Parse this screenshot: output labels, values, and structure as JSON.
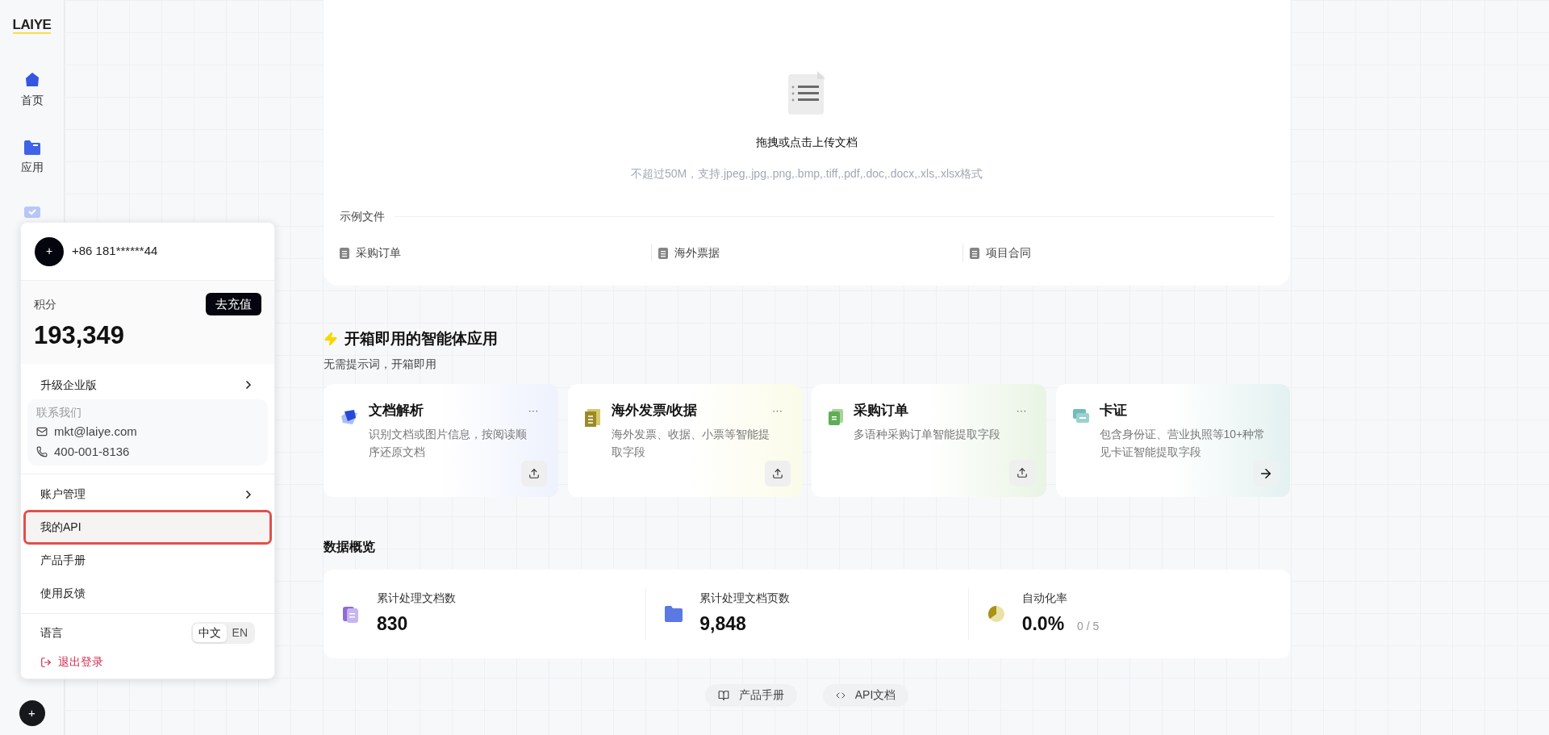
{
  "sidebar": {
    "logo": "LAIYE",
    "items": [
      {
        "label": "首页",
        "kind": "home"
      },
      {
        "label": "应用",
        "kind": "apps"
      }
    ]
  },
  "upload": {
    "title": "拖拽或点击上传文档",
    "hint": "不超过50M，支持.jpeg,.jpg,.png,.bmp,.tiff,.pdf,.doc,.docx,.xls,.xlsx格式",
    "samples_label": "示例文件",
    "samples": [
      "采购订单",
      "海外票据",
      "项目合同"
    ]
  },
  "apps_section": {
    "title": "开箱即用的智能体应用",
    "subtitle": "无需提示词，开箱即用",
    "cards": [
      {
        "kind": "parse",
        "title": "文档解析",
        "menu": "···",
        "description": "识别文档或图片信息，按阅读顺序还原文档",
        "arrow": false
      },
      {
        "kind": "invoice",
        "title": "海外发票/收据",
        "menu": "···",
        "description": "海外发票、收据、小票等智能提取字段",
        "arrow": false
      },
      {
        "kind": "order",
        "title": "采购订单",
        "menu": "···",
        "description": "多语种采购订单智能提取字段",
        "arrow": false
      },
      {
        "kind": "card",
        "title": "卡证",
        "description": "包含身份证、营业执照等10+种常见卡证智能提取字段",
        "arrow": true
      }
    ]
  },
  "overview": {
    "title": "数据概览",
    "stats": [
      {
        "kind": "docs",
        "label": "累计处理文档数",
        "value": "830"
      },
      {
        "kind": "pages",
        "label": "累计处理文档页数",
        "value": "9,848"
      },
      {
        "kind": "rate",
        "label": "自动化率",
        "value": "0.0%",
        "sub": "0 / 5"
      }
    ]
  },
  "footer_links": [
    {
      "kind": "book",
      "label": "产品手册"
    },
    {
      "kind": "code",
      "label": "API文档"
    }
  ],
  "popup": {
    "avatar": "+",
    "phone": "+86 181******44",
    "points_label": "积分",
    "recharge": "去充值",
    "points": "193,349",
    "upgrade": "升级企业版",
    "contact_title": "联系我们",
    "email": "mkt@laiye.com",
    "tel": "400-001-8136",
    "menu": [
      {
        "label": "账户管理",
        "submenu": true,
        "selected": false
      },
      {
        "label": "我的API",
        "submenu": false,
        "selected": true
      },
      {
        "label": "产品手册",
        "submenu": false,
        "selected": false
      },
      {
        "label": "使用反馈",
        "submenu": false,
        "selected": false
      }
    ],
    "language_label": "语言",
    "languages": [
      {
        "label": "中文",
        "selected": true
      },
      {
        "label": "EN",
        "selected": false
      }
    ],
    "logout": "退出登录"
  },
  "avatar_button": "+"
}
